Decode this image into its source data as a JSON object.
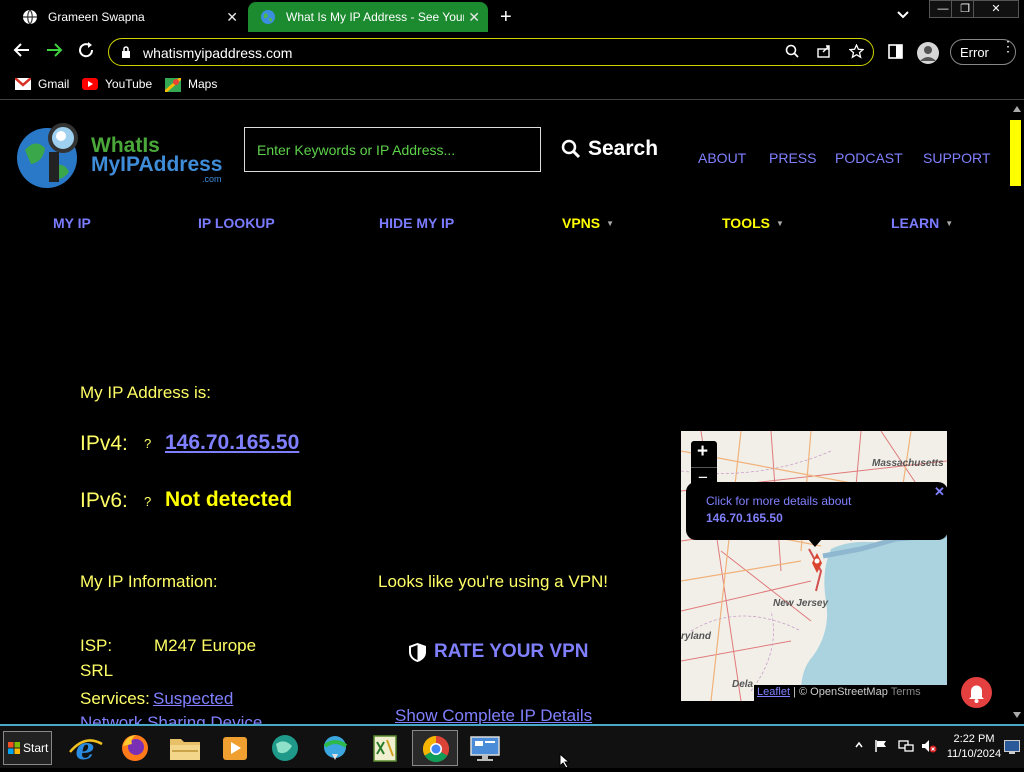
{
  "browser": {
    "tabs": [
      {
        "title": "Grameen Swapna",
        "close": "✕"
      },
      {
        "title": "What Is My IP Address - See Your P",
        "close": "✕"
      }
    ],
    "new_tab": "+",
    "url": "whatismyipaddress.com",
    "profile_label": "Error",
    "bookmarks": [
      "Gmail",
      "YouTube",
      "Maps"
    ],
    "window_controls": [
      "—",
      "❐",
      "✕"
    ]
  },
  "site": {
    "logo_line1": "WhatIs",
    "logo_line2": "MyIPAddress",
    "logo_com": ".com",
    "search_placeholder": "Enter Keywords or IP Address...",
    "search_label": "Search",
    "top_links": [
      "ABOUT",
      "PRESS",
      "PODCAST",
      "SUPPORT"
    ],
    "nav": [
      "MY IP",
      "IP LOOKUP",
      "HIDE MY IP",
      "VPNS",
      "TOOLS",
      "LEARN"
    ],
    "nav_caret": "▼",
    "ip_heading": "My IP Address is:",
    "ipv4_label": "IPv4:",
    "ipv4_value": "146.70.165.50",
    "ipv6_label": "IPv6:",
    "ipv6_value": "Not detected",
    "help_mark": "?",
    "info_heading": "My IP Information:",
    "isp_label": "ISP:",
    "isp_value_line1": "M247 Europe",
    "isp_value_line2": "SRL",
    "services_label": "Services:",
    "services_value_line1": "Suspected",
    "services_value_line2": "Network Sharing Device",
    "vpn_notice": "Looks like you're using a VPN!",
    "rate_vpn": "RATE YOUR VPN",
    "show_details": "Show Complete IP Details"
  },
  "map": {
    "zoom_in": "+",
    "zoom_out": "−",
    "popup_text": "Click for more details about",
    "popup_ip": "146.70.165.50",
    "popup_close": "✕",
    "labels": [
      "Massachusetts",
      "New Jersey",
      "ryland",
      "Dela"
    ],
    "attribution_leaflet": "Leaflet",
    "attribution_sep": " | © ",
    "attribution_osm": "OpenStreetMap",
    "attribution_terms": "Terms"
  },
  "taskbar": {
    "start_label": "Start",
    "time": "2:22 PM",
    "date": "11/10/2024"
  },
  "colors": {
    "accent_green": "#1c8a2e",
    "link_blue": "#8080ff",
    "highlight_yellow": "#ffff66",
    "taskbar_border": "#48a8c8"
  }
}
